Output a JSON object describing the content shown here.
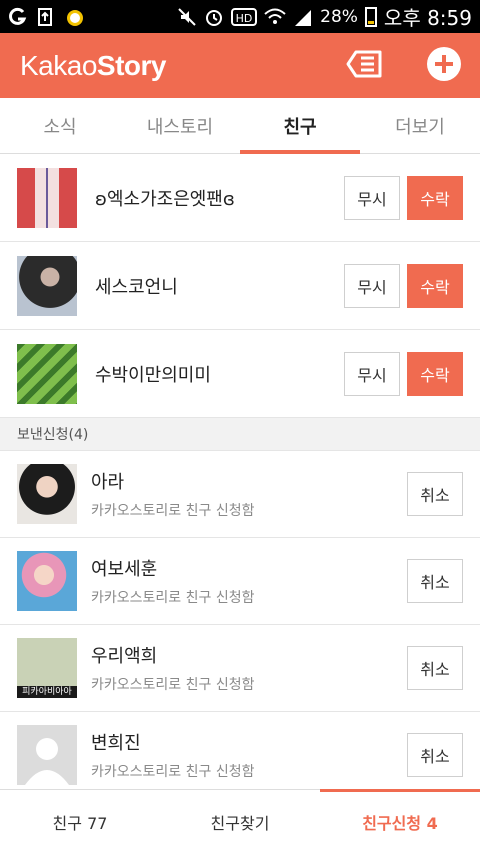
{
  "status_bar": {
    "battery": "28%",
    "time": "오후 8:59"
  },
  "app": {
    "logo_light": "Kakao",
    "logo_bold": "Story"
  },
  "tabs": [
    {
      "label": "소식"
    },
    {
      "label": "내스토리"
    },
    {
      "label": "친구",
      "active": true
    },
    {
      "label": "더보기"
    }
  ],
  "requests": [
    {
      "name": "ʚ엑소가조은엣팬ɞ",
      "ignore_label": "무시",
      "accept_label": "수락"
    },
    {
      "name": "세스코언니",
      "ignore_label": "무시",
      "accept_label": "수락"
    },
    {
      "name": "수박이만의미미",
      "ignore_label": "무시",
      "accept_label": "수락"
    }
  ],
  "sent_section": {
    "title": "보낸신청(4)",
    "items": [
      {
        "name": "아라",
        "sub": "카카오스토리로 친구 신청함",
        "cancel_label": "취소"
      },
      {
        "name": "여보세훈",
        "sub": "카카오스토리로 친구 신청함",
        "cancel_label": "취소"
      },
      {
        "name": "우리액희",
        "sub": "카카오스토리로 친구 신청함",
        "cancel_label": "취소",
        "avatar_caption": "피카아비아아"
      },
      {
        "name": "변희진",
        "sub": "카카오스토리로 친구 신청함",
        "cancel_label": "취소"
      }
    ]
  },
  "bottom_tabs": [
    {
      "label": "친구 77"
    },
    {
      "label": "친구찾기"
    },
    {
      "label": "친구신청 4",
      "active": true
    }
  ],
  "colors": {
    "accent": "#f06b50"
  }
}
